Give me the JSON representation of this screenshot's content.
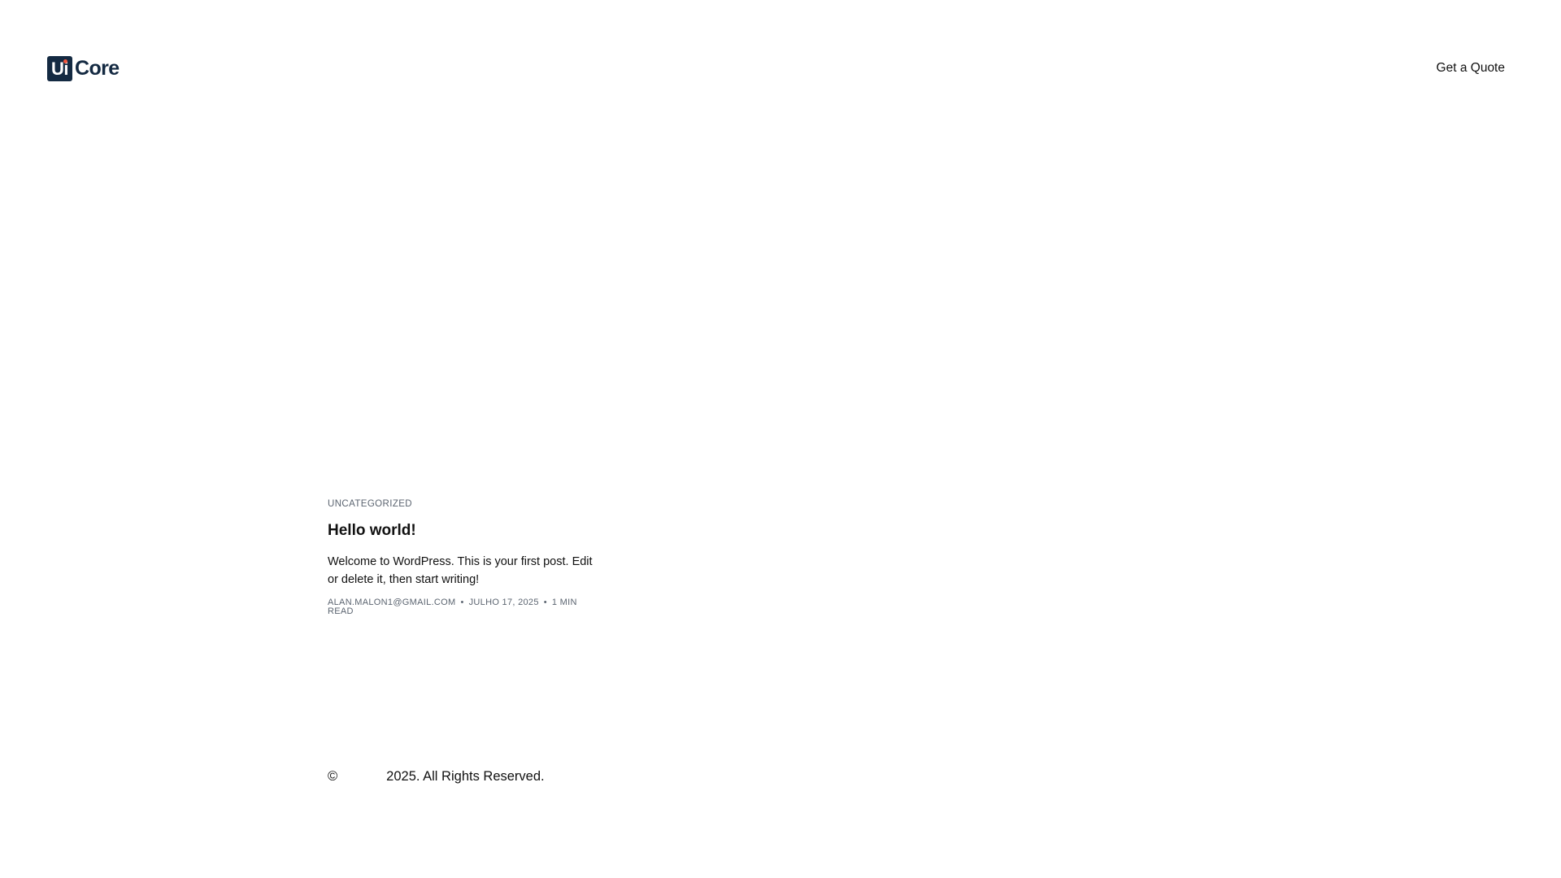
{
  "header": {
    "logo": {
      "badge_text": "Ui",
      "wordmark": "Core",
      "brand_color": "#142a42",
      "dot_color": "#f2553b"
    },
    "nav": {
      "quote_label": "Get a Quote"
    }
  },
  "post": {
    "category": "UNCATEGORIZED",
    "title": "Hello world!",
    "excerpt": "Welcome to WordPress. This is your first post. Edit or delete it, then start writing!",
    "author": "ALAN.MALON1@GMAIL.COM",
    "date": "JULHO 17, 2025",
    "separator": "•",
    "read_time": "1 MIN READ"
  },
  "footer": {
    "copyright_symbol": "©",
    "copyright_text": "2025. All Rights Reserved."
  }
}
